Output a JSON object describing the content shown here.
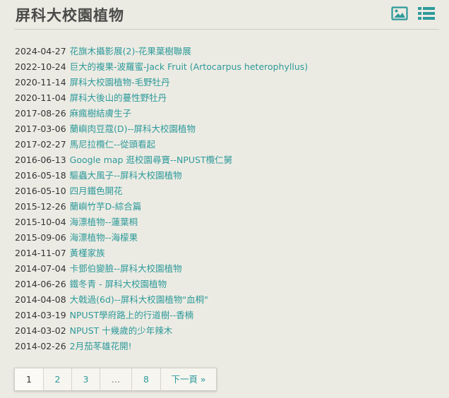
{
  "header": {
    "title": "屏科大校園植物",
    "accent_color": "#2e9a9b",
    "icons": [
      "image-icon",
      "list-view-icon"
    ]
  },
  "posts": [
    {
      "date": "2024-04-27",
      "title": "花旗木攝影展(2)-花果葉樹聯展"
    },
    {
      "date": "2022-10-24",
      "title": "巨大的複果-波羅蜜-Jack Fruit (Artocarpus heterophyllus)"
    },
    {
      "date": "2020-11-14",
      "title": "屏科大校園植物-毛野牡丹"
    },
    {
      "date": "2020-11-04",
      "title": "屏科大後山的蔓性野牡丹"
    },
    {
      "date": "2017-08-26",
      "title": "麻瘋樹結膚生子"
    },
    {
      "date": "2017-03-06",
      "title": "蘭嶼肉豆蔻(D)--屏科大校園植物"
    },
    {
      "date": "2017-02-27",
      "title": "馬尼拉欖仁--從頭看起"
    },
    {
      "date": "2016-06-13",
      "title": "Google map 逛校園尋寶--NPUST欖仁舅"
    },
    {
      "date": "2016-05-18",
      "title": "驅蟲大風子--屏科大校園植物"
    },
    {
      "date": "2016-05-10",
      "title": "四月鐵色開花"
    },
    {
      "date": "2015-12-26",
      "title": "蘭嶼竹芋D-綜合篇"
    },
    {
      "date": "2015-10-04",
      "title": "海漂植物--蓮葉桐"
    },
    {
      "date": "2015-09-06",
      "title": "海漂植物--海檬果"
    },
    {
      "date": "2014-11-07",
      "title": "黃槿家族"
    },
    {
      "date": "2014-07-04",
      "title": "卡鄧伯變臉--屏科大校園植物"
    },
    {
      "date": "2014-06-26",
      "title": "鐵冬青 - 屏科大校園植物"
    },
    {
      "date": "2014-04-08",
      "title": "大戟過(6d)--屏科大校園植物\"血桐\""
    },
    {
      "date": "2014-03-19",
      "title": "NPUST學府路上的行道樹--香楠"
    },
    {
      "date": "2014-03-02",
      "title": "NPUST 十幾歲的少年辣木"
    },
    {
      "date": "2014-02-26",
      "title": "2月茄苳雄花開!"
    }
  ],
  "pagination": {
    "pages": [
      "1",
      "2",
      "3",
      "…",
      "8"
    ],
    "current": "1",
    "next_label": "下一頁 »"
  }
}
